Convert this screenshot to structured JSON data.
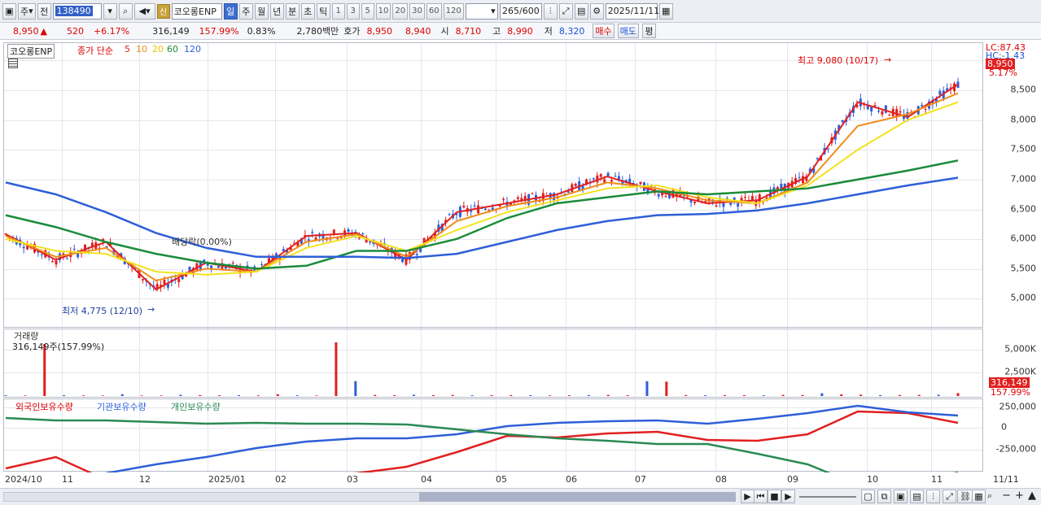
{
  "toolbar": {
    "market": "주",
    "all": "전",
    "code": "138490",
    "shin": "신",
    "name": "코오롱ENP",
    "periods": [
      "일",
      "주",
      "월",
      "년",
      "분",
      "초",
      "틱"
    ],
    "active_period": "일",
    "nums": [
      "1",
      "3",
      "5",
      "10",
      "20",
      "30",
      "60",
      "120"
    ],
    "count": "265",
    "count_total": "/600",
    "date": "2025/11/11"
  },
  "quote": {
    "price": "8,950",
    "change_sign": "▲",
    "change": "520",
    "change_pct": "+6.17%",
    "volume": "316,149",
    "vol_ratio": "157.99%",
    "turnover": "0.83%",
    "amount": "2,780백만",
    "bid_label": "호가",
    "ask": "8,950",
    "bid": "8,940",
    "open_label": "시",
    "open": "8,710",
    "high_label": "고",
    "high": "8,990",
    "low_label": "저",
    "low": "8,320",
    "buy": "매수",
    "sell": "매도",
    "avg": "평"
  },
  "legend": {
    "name": "코오롱ENP",
    "close_label": "종가 단순",
    "ma": [
      "5",
      "10",
      "20",
      "60",
      "120"
    ],
    "ma_colors": [
      "#e02020",
      "#f08c1a",
      "#f2e21e",
      "#1a8c3a",
      "#2e5fd8"
    ]
  },
  "annot": {
    "high": "최고 9,080 (10/17)",
    "low": "최저 4,775 (12/10)",
    "dividend": "배당락(0.00%)",
    "lc": "LC:87.43",
    "hc": "HC:-1.43",
    "last_price": "8,950",
    "last_pct": "5.17%"
  },
  "volume_panel": {
    "title": "거래량",
    "value": "316,149주(157.99%)",
    "last": "316,149",
    "pct": "157.99%"
  },
  "holding_panel": {
    "series": [
      "외국인보유수량",
      "기관보유수량",
      "개인보유수량"
    ],
    "colors": [
      "#e02020",
      "#2e5fd8",
      "#2a8a55"
    ]
  },
  "chart_data": [
    {
      "type": "line",
      "title": "코오롱ENP 일봉",
      "x": [
        "2024/10",
        "11",
        "12",
        "2025/01",
        "02",
        "03",
        "04",
        "05",
        "06",
        "07",
        "08",
        "09",
        "10",
        "11"
      ],
      "y_ticks": [
        "5,000",
        "5,500",
        "6,000",
        "6,500",
        "7,000",
        "7,500",
        "8,000",
        "8,500"
      ],
      "ylim": [
        4700,
        9200
      ],
      "series": [
        {
          "name": "5",
          "values": [
            6080,
            5650,
            5950,
            5150,
            5600,
            5450,
            6050,
            6100,
            5650,
            6450,
            6600,
            6750,
            7050,
            6800,
            6600,
            6650,
            7050,
            8300,
            8050,
            8600
          ]
        },
        {
          "name": "10",
          "values": [
            6050,
            5700,
            5850,
            5300,
            5500,
            5450,
            5950,
            6080,
            5700,
            6300,
            6550,
            6700,
            6950,
            6850,
            6650,
            6600,
            6950,
            7900,
            8100,
            8450
          ]
        },
        {
          "name": "20",
          "values": [
            6000,
            5800,
            5750,
            5450,
            5400,
            5450,
            5850,
            6050,
            5800,
            6150,
            6450,
            6650,
            6850,
            6900,
            6700,
            6600,
            6900,
            7500,
            8000,
            8300
          ]
        },
        {
          "name": "60",
          "values": [
            6400,
            6200,
            5950,
            5750,
            5600,
            5500,
            5550,
            5800,
            5800,
            6000,
            6350,
            6600,
            6700,
            6800,
            6750,
            6800,
            6850,
            7000,
            7150,
            7320
          ]
        },
        {
          "name": "120",
          "values": [
            6950,
            6750,
            6450,
            6100,
            5850,
            5700,
            5700,
            5700,
            5680,
            5750,
            5950,
            6150,
            6300,
            6400,
            6420,
            6480,
            6600,
            6750,
            6900,
            7030
          ]
        }
      ],
      "annotations": {
        "high": "9,080 (10/17)",
        "low": "4,775 (12/10)"
      }
    },
    {
      "type": "bar",
      "title": "거래량",
      "y_ticks": [
        "2,500K",
        "5,000K"
      ],
      "values": [
        80,
        60,
        5600,
        90,
        70,
        60,
        200,
        60,
        60,
        140,
        100,
        80,
        90,
        70,
        200,
        80,
        60,
        5800,
        1600,
        120,
        90,
        140,
        100,
        120,
        80,
        90,
        100,
        90,
        70,
        80,
        100,
        120,
        90,
        1600,
        1550,
        100,
        80,
        90,
        90,
        80,
        130,
        110,
        300,
        180,
        150,
        100,
        110,
        120,
        140,
        316
      ]
    },
    {
      "type": "line",
      "title": "보유수량",
      "y_ticks": [
        "250,000",
        "0",
        "-250,000"
      ],
      "series": [
        {
          "name": "외국인보유수량",
          "values": [
            -500000,
            -360000,
            -640000,
            -650000,
            -620000,
            -640000,
            -600000,
            -560000,
            -480000,
            -300000,
            -100000,
            -120000,
            -70000,
            -50000,
            -150000,
            -160000,
            -80000,
            200000,
            180000,
            60000
          ]
        },
        {
          "name": "기관보유수량",
          "values": [
            -620000,
            -620000,
            -560000,
            -450000,
            -360000,
            -250000,
            -170000,
            -130000,
            -130000,
            -80000,
            20000,
            60000,
            80000,
            90000,
            50000,
            110000,
            180000,
            270000,
            190000,
            150000
          ]
        },
        {
          "name": "개인보유수량",
          "values": [
            120000,
            90000,
            90000,
            70000,
            50000,
            60000,
            50000,
            50000,
            40000,
            -20000,
            -80000,
            -130000,
            -160000,
            -200000,
            -200000,
            -320000,
            -450000,
            -700000,
            -680000,
            -550000
          ]
        }
      ]
    }
  ]
}
